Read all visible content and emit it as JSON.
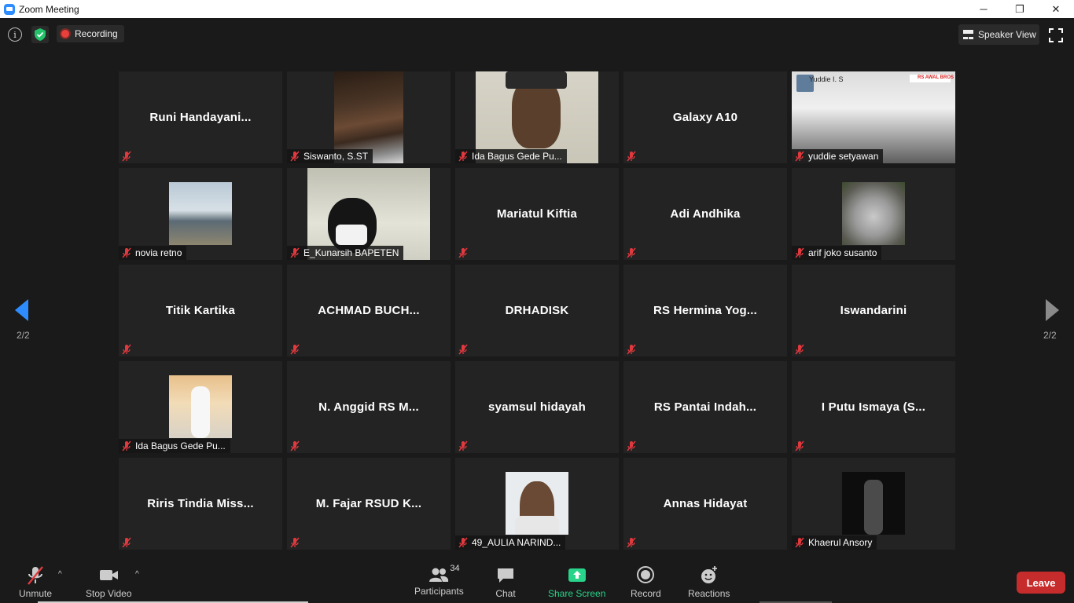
{
  "window": {
    "title": "Zoom Meeting",
    "controls": [
      "─",
      "❐",
      "✕"
    ]
  },
  "topbar": {
    "recording_label": "Recording",
    "view_label": "Speaker View"
  },
  "paging": {
    "left": "2/2",
    "right": "2/2"
  },
  "participants": [
    {
      "display": "Runi  Handayani...",
      "label": "",
      "video": false
    },
    {
      "display": "",
      "label": "Siswanto, S.ST",
      "video": true
    },
    {
      "display": "",
      "label": "Ida Bagus Gede Pu...",
      "video": true
    },
    {
      "display": "Galaxy A10",
      "label": "",
      "video": false
    },
    {
      "display": "",
      "label": "yuddie setyawan",
      "video": true,
      "overlay_text": "Yuddie I. S",
      "overlay_logo": "RS AWAL BROS"
    },
    {
      "display": "",
      "label": "novia retno",
      "video": false,
      "avatar": true
    },
    {
      "display": "",
      "label": "E_Kunarsih BAPETEN",
      "video": true
    },
    {
      "display": "Mariatul Kiftia",
      "label": "",
      "video": false
    },
    {
      "display": "Adi Andhika",
      "label": "",
      "video": false
    },
    {
      "display": "",
      "label": "arif joko susanto",
      "video": false,
      "avatar": true
    },
    {
      "display": "Titik Kartika",
      "label": "",
      "video": false
    },
    {
      "display": "ACHMAD  BUCH...",
      "label": "",
      "video": false
    },
    {
      "display": "DRHADISK",
      "label": "",
      "video": false
    },
    {
      "display": "RS  Hermina  Yog...",
      "label": "",
      "video": false
    },
    {
      "display": "Iswandarini",
      "label": "",
      "video": false
    },
    {
      "display": "",
      "label": "Ida Bagus Gede Pu...",
      "video": false,
      "avatar": true
    },
    {
      "display": "N.  Anggid  RS  M...",
      "label": "",
      "video": false
    },
    {
      "display": "syamsul hidayah",
      "label": "",
      "video": false
    },
    {
      "display": "RS  Pantai  Indah...",
      "label": "",
      "video": false
    },
    {
      "display": "I  Putu  Ismaya  (S...",
      "label": "",
      "video": false
    },
    {
      "display": "Riris  Tindia  Miss...",
      "label": "",
      "video": false
    },
    {
      "display": "M.  Fajar  RSUD  K...",
      "label": "",
      "video": false
    },
    {
      "display": "",
      "label": "49_AULIA NARIND...",
      "video": false,
      "avatar": true
    },
    {
      "display": "Annas Hidayat",
      "label": "",
      "video": false
    },
    {
      "display": "",
      "label": "Khaerul Ansory",
      "video": false,
      "avatar": true
    }
  ],
  "toolbar": {
    "unmute": "Unmute",
    "stop_video": "Stop Video",
    "participants": "Participants",
    "participants_count": "34",
    "chat": "Chat",
    "share_screen": "Share Screen",
    "record": "Record",
    "reactions": "Reactions",
    "leave": "Leave"
  },
  "colors": {
    "accent_green": "#27d48a",
    "leave_red": "#c72c2c",
    "mute_red": "#e0393e",
    "zoom_blue": "#2d8cff"
  }
}
